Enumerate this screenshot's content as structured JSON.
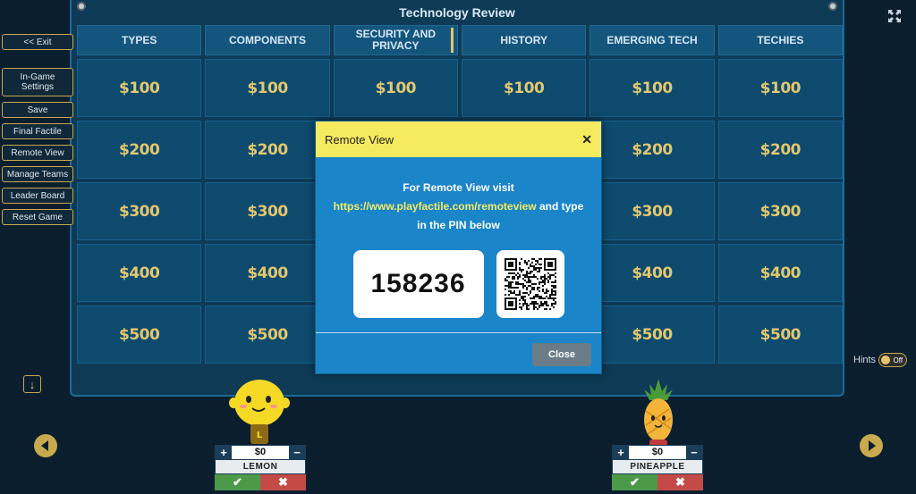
{
  "board": {
    "title": "Technology Review",
    "categories": [
      "TYPES",
      "COMPONENTS",
      "SECURITY AND PRIVACY",
      "HISTORY",
      "EMERGING TECH",
      "TECHIES"
    ],
    "rows": [
      "$100",
      "$200",
      "$300",
      "$400",
      "$500"
    ]
  },
  "menu": {
    "exit": "<< Exit",
    "settings": "In-Game Settings",
    "save": "Save",
    "final": "Final Factile",
    "remote": "Remote View",
    "teams": "Manage Teams",
    "leader": "Leader Board",
    "reset": "Reset Game"
  },
  "hints": {
    "label": "Hints",
    "state": "Off"
  },
  "teams": [
    {
      "name": "LEMON",
      "score": "$0"
    },
    {
      "name": "PINEAPPLE",
      "score": "$0"
    }
  ],
  "modal": {
    "title": "Remote View",
    "line1": "For Remote View visit",
    "link": "https://www.playfactile.com/remoteview",
    "line2": " and type",
    "line3": "in the PIN below",
    "pin": "158236",
    "close": "Close"
  },
  "icons": {
    "expand": "expand-icon",
    "close": "close-icon",
    "down": "download-icon",
    "prev": "prev-arrow-icon",
    "next": "next-arrow-icon",
    "qr": "qr-code-icon"
  },
  "colors": {
    "accent": "#f6ea5e",
    "gold": "#e3c76d",
    "modal": "#1a85c9"
  }
}
